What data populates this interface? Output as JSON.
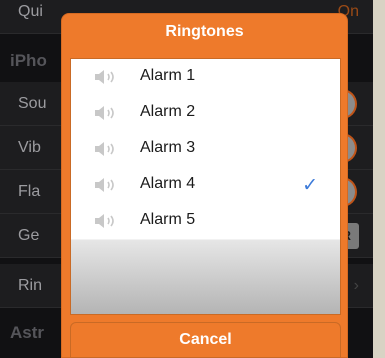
{
  "background": {
    "rows": [
      {
        "label": "Qui",
        "value": "On"
      },
      {
        "label": "Sou"
      },
      {
        "label": "Vib"
      },
      {
        "label": "Fla"
      },
      {
        "label": "Ge",
        "button": "AR"
      },
      {
        "label": "Rin",
        "value": "3"
      }
    ],
    "sections": [
      "iPho",
      "Astr"
    ]
  },
  "dialog": {
    "title": "Ringtones",
    "items": [
      {
        "label": "Alarm 1",
        "icon": "speaker-icon",
        "selected": false
      },
      {
        "label": "Alarm 2",
        "icon": "speaker-icon",
        "selected": false
      },
      {
        "label": "Alarm 3",
        "icon": "speaker-icon",
        "selected": false
      },
      {
        "label": "Alarm 4",
        "icon": "speaker-icon",
        "selected": true
      },
      {
        "label": "Alarm 5",
        "icon": "speaker-icon",
        "selected": false
      }
    ],
    "checkmark": "✓",
    "cancel_label": "Cancel"
  },
  "colors": {
    "accent": "#ee7a2b",
    "check": "#3d7bd9"
  }
}
